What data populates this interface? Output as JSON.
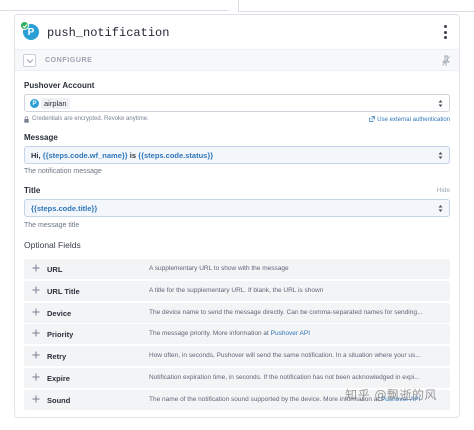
{
  "step": {
    "title": "push_notification"
  },
  "configure": {
    "label": "CONFIGURE"
  },
  "account": {
    "label": "Pushover Account",
    "badge_letter": "P",
    "value": "airplan",
    "credentials_note": "Credentials are encrypted. Revoke anytime.",
    "external_auth_link": "Use external authentication"
  },
  "message": {
    "label": "Message",
    "value_prefix": "Hi, ",
    "value_expr1": "{{steps.code.wf_name}}",
    "value_mid": " is ",
    "value_expr2": "{{steps.code.status}}",
    "help": "The notification message"
  },
  "title_field": {
    "label": "Title",
    "hide_label": "Hide",
    "value": "{{steps.code.title}}",
    "help": "The message title"
  },
  "optional": {
    "heading": "Optional Fields",
    "rows": [
      {
        "name": "URL",
        "desc": "A supplementary URL to show with the message",
        "link": ""
      },
      {
        "name": "URL Title",
        "desc": "A title for the supplementary URL. If blank, the URL is shown",
        "link": ""
      },
      {
        "name": "Device",
        "desc": "The device name to send the message directly. Can be comma-separated names for sending...",
        "link": ""
      },
      {
        "name": "Priority",
        "desc": "The message priority. More information at ",
        "link": "Pushover API"
      },
      {
        "name": "Retry",
        "desc": "How often, in seconds, Pushover will send the same notification. In a situation where your us...",
        "link": ""
      },
      {
        "name": "Expire",
        "desc": "Notification expiration time, in seconds. If the notification has not been acknowledged in expi...",
        "link": ""
      },
      {
        "name": "Sound",
        "desc": "The name of the notification sound supported by the device. More information at ",
        "link": "Pushover API"
      }
    ]
  },
  "watermark": "知乎 @飘逝的风",
  "colors": {
    "accent_blue": "#2f76b8",
    "pushover_blue": "#2a9fd6",
    "success_green": "#2fae60"
  },
  "icons": {
    "status": "check-icon",
    "menu": "kebab-menu-icon",
    "collapse": "chevron-down-icon",
    "pin": "pin-icon",
    "select": "updown-arrows-icon",
    "lock": "lock-icon",
    "external": "external-link-icon",
    "add": "plus-icon"
  }
}
